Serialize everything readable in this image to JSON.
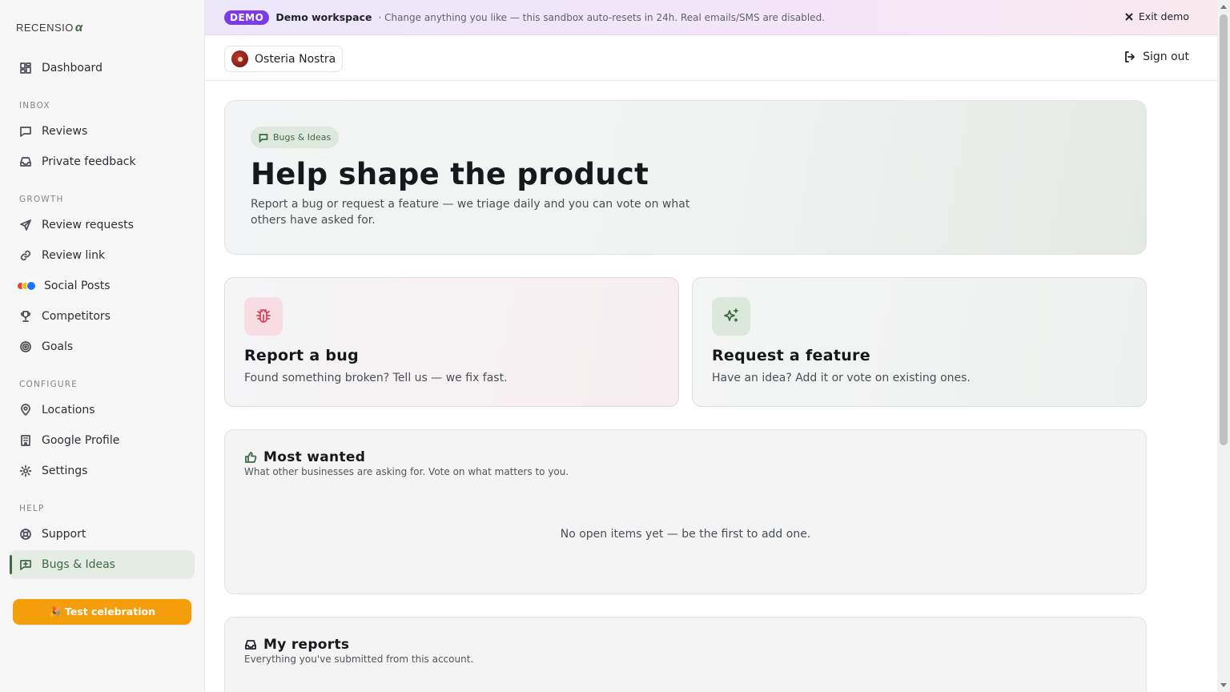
{
  "brand": {
    "logo_text": "RECENSIO",
    "logo_mark": "α"
  },
  "sidebar": {
    "dashboard": "Dashboard",
    "sections": {
      "inbox": "INBOX",
      "growth": "GROWTH",
      "configure": "CONFIGURE",
      "help": "HELP"
    },
    "items": {
      "reviews": "Reviews",
      "private_feedback": "Private feedback",
      "review_requests": "Review requests",
      "review_link": "Review link",
      "social_posts": "Social Posts",
      "competitors": "Competitors",
      "goals": "Goals",
      "locations": "Locations",
      "google_profile": "Google Profile",
      "settings": "Settings",
      "support": "Support",
      "bugs_ideas": "Bugs & Ideas"
    },
    "active": "bugs_ideas",
    "celebration_button": "🎉 Test celebration"
  },
  "banner": {
    "badge": "DEMO",
    "workspace": "Demo workspace",
    "message": "· Change anything you like — this sandbox auto-resets in 24h. Real emails/SMS are disabled.",
    "exit_label": "Exit demo"
  },
  "topbar": {
    "location_name": "Osteria Nostra",
    "signout_label": "Sign out"
  },
  "hero": {
    "pill": "Bugs & Ideas",
    "title": "Help shape the product",
    "subtitle": "Report a bug or request a feature — we triage daily and you can vote on what others have asked for."
  },
  "cards": {
    "bug": {
      "title": "Report a bug",
      "description": "Found something broken? Tell us — we fix fast."
    },
    "feature": {
      "title": "Request a feature",
      "description": "Have an idea? Add it or vote on existing ones."
    }
  },
  "most_wanted": {
    "title": "Most wanted",
    "subtitle": "What other businesses are asking for. Vote on what matters to you.",
    "empty": "No open items yet — be the first to add one."
  },
  "my_reports": {
    "title": "My reports",
    "subtitle": "Everything you've submitted from this account."
  },
  "colors": {
    "accent": "#3d6b45",
    "demo_badge": "#7c3aed",
    "celebration": "#f59e0b",
    "bug_accent": "#d6455f"
  }
}
